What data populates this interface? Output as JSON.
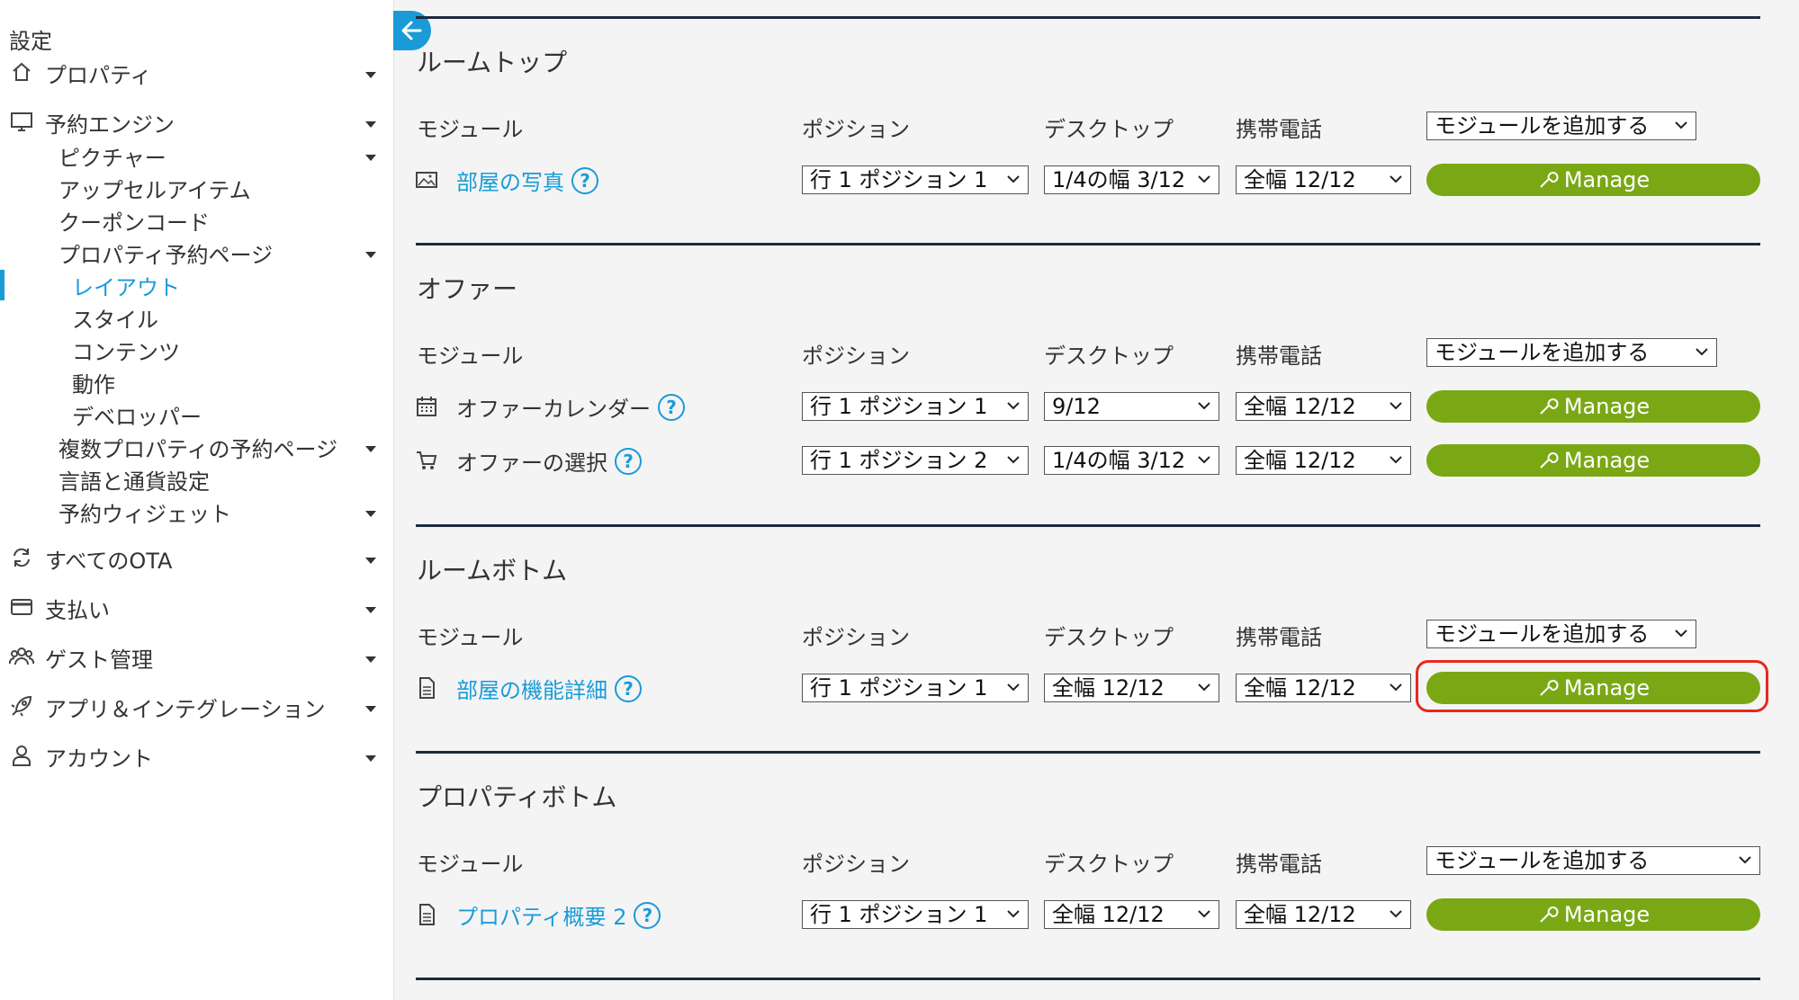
{
  "sidebar": {
    "heading": "設定",
    "items": [
      {
        "label": "プロパティ",
        "icon": "home-icon"
      },
      {
        "label": "予約エンジン",
        "icon": "monitor-icon"
      },
      {
        "label": "ピクチャー"
      },
      {
        "label": "アップセルアイテム"
      },
      {
        "label": "クーポンコード"
      },
      {
        "label": "プロパティ予約ページ"
      },
      {
        "label": "レイアウト",
        "active": true
      },
      {
        "label": "スタイル"
      },
      {
        "label": "コンテンツ"
      },
      {
        "label": "動作"
      },
      {
        "label": "デベロッパー"
      },
      {
        "label": "複数プロパティの予約ページ"
      },
      {
        "label": "言語と通貨設定"
      },
      {
        "label": "予約ウィジェット"
      },
      {
        "label": "すべてのOTA",
        "icon": "sync-icon"
      },
      {
        "label": "支払い",
        "icon": "credit-card-icon"
      },
      {
        "label": "ゲスト管理",
        "icon": "users-icon"
      },
      {
        "label": "アプリ＆インテグレーション",
        "icon": "rocket-icon"
      },
      {
        "label": "アカウント",
        "icon": "user-icon"
      }
    ]
  },
  "columns": {
    "module": "モジュール",
    "position": "ポジション",
    "desktop": "デスクトップ",
    "mobile": "携帯電話",
    "add": "モジュールを追加する"
  },
  "manage_label": "Manage",
  "sections": [
    {
      "title": "ルームトップ",
      "modules": [
        {
          "name": "部屋の写真",
          "icon": "image-icon",
          "position": "行 1 ポジション 1",
          "desktop": "1/4の幅 3/12",
          "mobile": "全幅 12/12"
        }
      ]
    },
    {
      "title": "オファー",
      "modules": [
        {
          "name": "オファーカレンダー",
          "icon": "calendar-icon",
          "position": "行 1 ポジション 1",
          "desktop": "9/12",
          "mobile": "全幅 12/12"
        },
        {
          "name": "オファーの選択",
          "icon": "cart-icon",
          "position": "行 1 ポジション 2",
          "desktop": "1/4の幅 3/12",
          "mobile": "全幅 12/12"
        }
      ]
    },
    {
      "title": "ルームボトム",
      "modules": [
        {
          "name": "部屋の機能詳細",
          "icon": "document-icon",
          "position": "行 1 ポジション 1",
          "desktop": "全幅 12/12",
          "mobile": "全幅 12/12"
        }
      ]
    },
    {
      "title": "プロパティボトム",
      "modules": [
        {
          "name": "プロパティ概要 2",
          "icon": "document-icon",
          "position": "行 1 ポジション 1",
          "desktop": "全幅 12/12",
          "mobile": "全幅 12/12"
        }
      ]
    }
  ],
  "colors": {
    "accent": "#1a9bd7",
    "manage": "#7aa814",
    "highlight": "#e8281e",
    "rule": "#1b2b3f"
  }
}
